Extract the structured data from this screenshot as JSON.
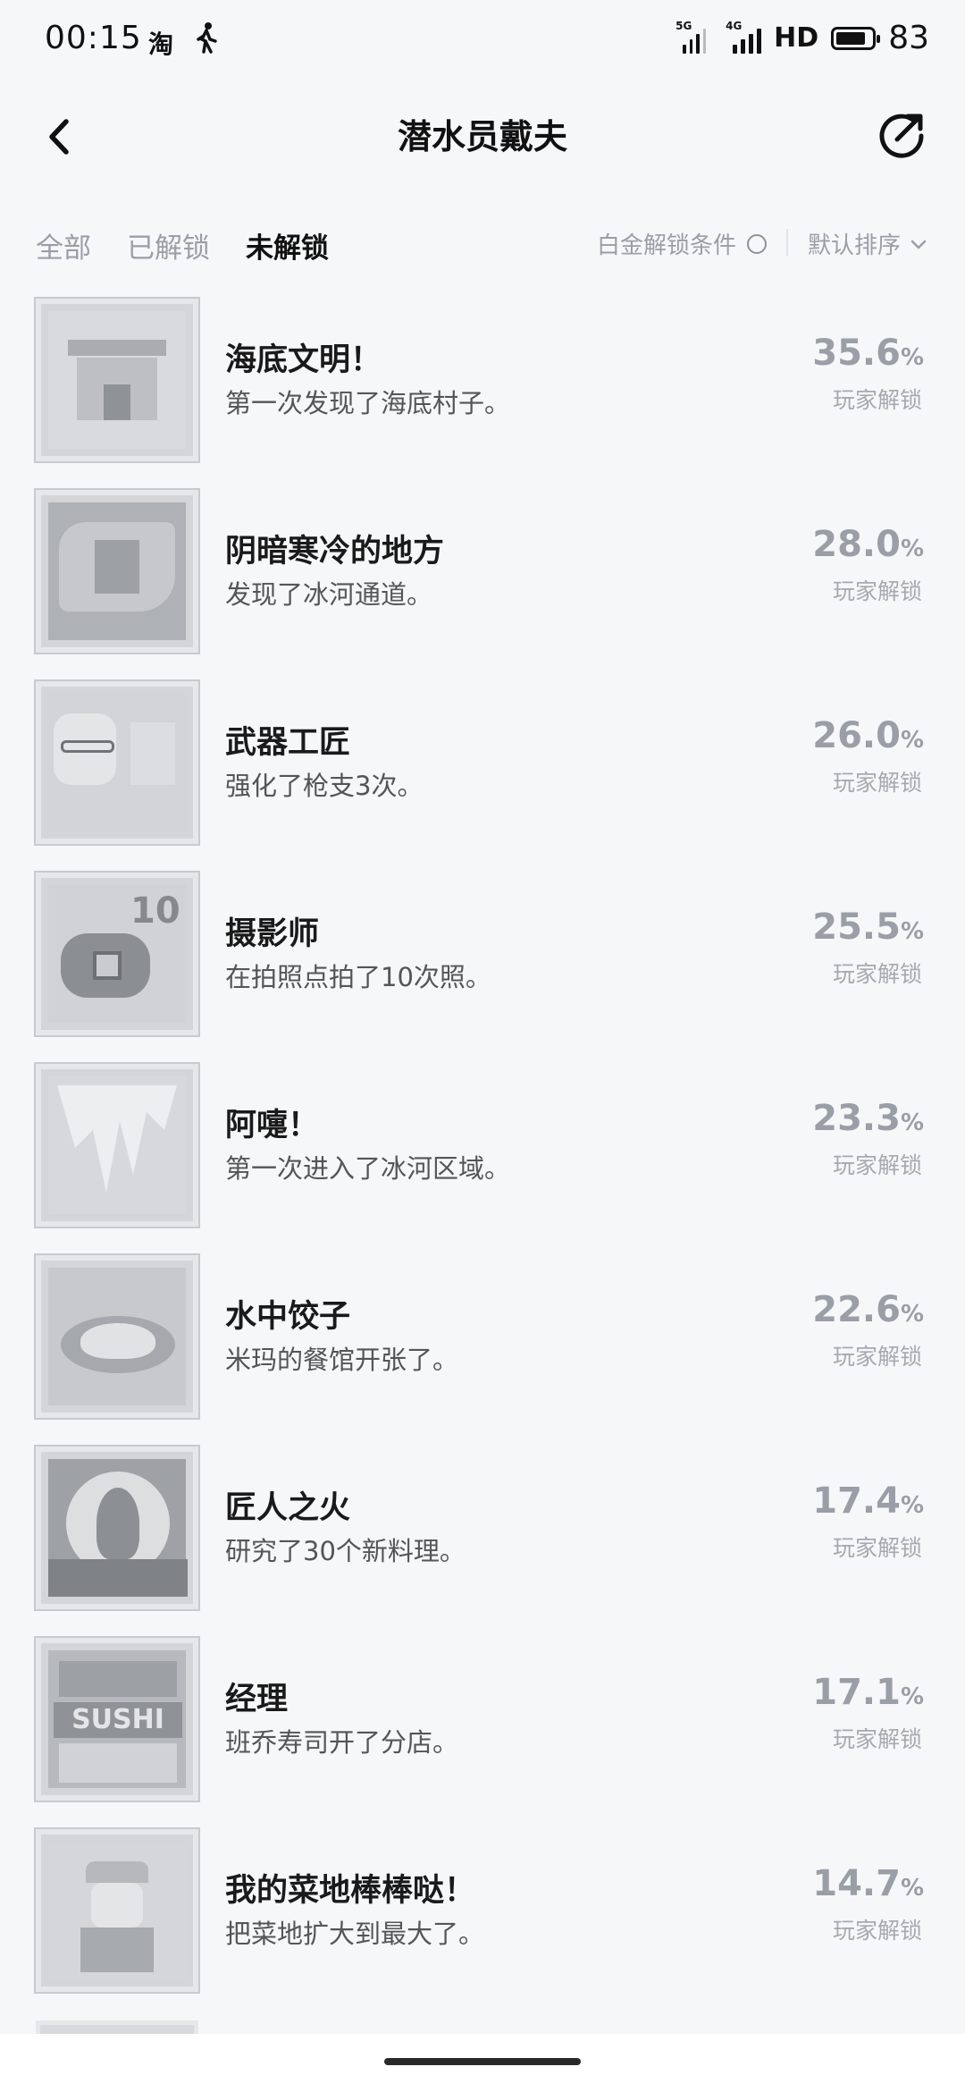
{
  "status_bar": {
    "time": "00:15",
    "app_icon": "淘",
    "walk_icon": "walk-icon",
    "signal1_tag": "5G",
    "signal2_tag": "4G",
    "hd": "HD",
    "battery_level": 83,
    "battery_text": "83"
  },
  "header": {
    "title": "潜水员戴夫",
    "back_icon": "back-chevron-icon",
    "share_icon": "share-icon"
  },
  "filters": {
    "tabs": [
      {
        "label": "全部",
        "active": false
      },
      {
        "label": "已解锁",
        "active": false
      },
      {
        "label": "未解锁",
        "active": true
      }
    ],
    "platinum_condition": "白金解锁条件",
    "sort": "默认排序"
  },
  "achievements": [
    {
      "name": "海底文明！",
      "desc": "第一次发现了海底村子。",
      "percent": "35.6",
      "unit": "%",
      "label": "玩家解锁",
      "icon": "temple-icon"
    },
    {
      "name": "阴暗寒冷的地方",
      "desc": "发现了冰河通道。",
      "percent": "28.0",
      "unit": "%",
      "label": "玩家解锁",
      "icon": "cave-icon"
    },
    {
      "name": "武器工匠",
      "desc": "强化了枪支3次。",
      "percent": "26.0",
      "unit": "%",
      "label": "玩家解锁",
      "icon": "craftsman-icon"
    },
    {
      "name": "摄影师",
      "desc": "在拍照点拍了10次照。",
      "percent": "25.5",
      "unit": "%",
      "label": "玩家解锁",
      "icon": "camera-icon",
      "badge": "10"
    },
    {
      "name": "阿嚏！",
      "desc": "第一次进入了冰河区域。",
      "percent": "23.3",
      "unit": "%",
      "label": "玩家解锁",
      "icon": "icicle-icon"
    },
    {
      "name": "水中饺子",
      "desc": "米玛的餐馆开张了。",
      "percent": "22.6",
      "unit": "%",
      "label": "玩家解锁",
      "icon": "dumpling-icon"
    },
    {
      "name": "匠人之火",
      "desc": "研究了30个新料理。",
      "percent": "17.4",
      "unit": "%",
      "label": "玩家解锁",
      "icon": "flame-icon"
    },
    {
      "name": "经理",
      "desc": "班乔寿司开了分店。",
      "percent": "17.1",
      "unit": "%",
      "label": "玩家解锁",
      "icon": "sushi-shop-icon",
      "badge": "SUSHI"
    },
    {
      "name": "我的菜地棒棒哒！",
      "desc": "把菜地扩大到最大了。",
      "percent": "14.7",
      "unit": "%",
      "label": "玩家解锁",
      "icon": "farmer-icon"
    }
  ]
}
